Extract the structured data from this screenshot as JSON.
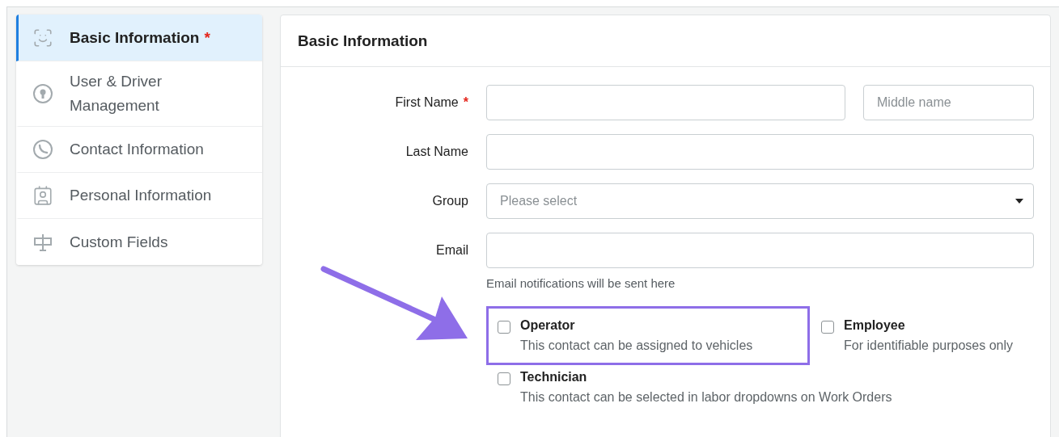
{
  "sidebar": {
    "items": [
      {
        "label": "Basic Information",
        "required_mark": "*",
        "selected": true
      },
      {
        "label": "User & Driver Management",
        "selected": false
      },
      {
        "label": "Contact Information",
        "selected": false
      },
      {
        "label": "Personal Information",
        "selected": false
      },
      {
        "label": "Custom Fields",
        "selected": false
      }
    ]
  },
  "panel": {
    "title": "Basic Information",
    "rows": [
      {
        "kind": "double",
        "label": "First Name",
        "required_mark": "*",
        "middle_placeholder": "Middle name"
      },
      {
        "kind": "text",
        "label": "Last Name"
      },
      {
        "kind": "select",
        "label": "Group",
        "placeholder": "Please select"
      },
      {
        "kind": "text",
        "label": "Email",
        "help": "Email notifications will be sent here"
      }
    ],
    "options": [
      {
        "label": "Operator",
        "description": "This contact can be assigned to vehicles",
        "checked": false,
        "highlighted": true
      },
      {
        "label": "Employee",
        "description": "For identifiable purposes only",
        "checked": false,
        "highlighted": false
      },
      {
        "label": "Technician",
        "description": "This contact can be selected in labor dropdowns on Work Orders",
        "checked": false,
        "highlighted": false
      }
    ]
  }
}
